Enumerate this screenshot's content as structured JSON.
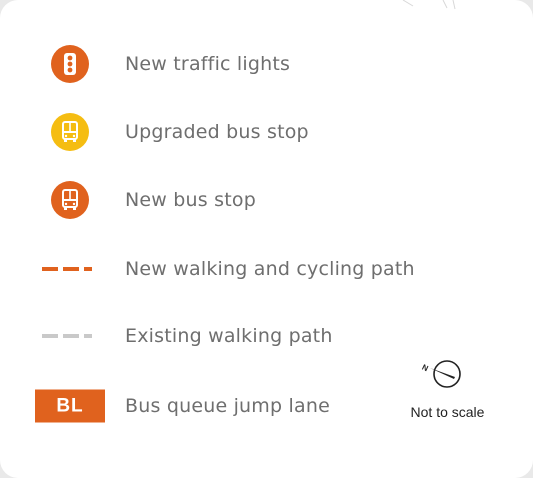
{
  "legend": {
    "items": [
      {
        "key": "traffic-lights",
        "label": "New traffic lights",
        "icon": "traffic-light-icon",
        "color": "#e0621e"
      },
      {
        "key": "upgraded-bus-stop",
        "label": "Upgraded bus stop",
        "icon": "bus-icon",
        "color": "#f5bd12"
      },
      {
        "key": "new-bus-stop",
        "label": "New bus stop",
        "icon": "bus-icon",
        "color": "#e0621e"
      },
      {
        "key": "new-path",
        "label": "New walking and cycling path",
        "icon": "dashed-line-icon",
        "color": "#e0621e"
      },
      {
        "key": "existing-path",
        "label": "Existing walking path",
        "icon": "dashed-line-icon",
        "color": "#c9c9c9"
      },
      {
        "key": "queue-jump",
        "label": "Bus queue jump lane",
        "badge": "BL",
        "color": "#e0621e"
      }
    ]
  },
  "north_arrow": {
    "letter": "N",
    "scale_note": "Not to scale"
  }
}
